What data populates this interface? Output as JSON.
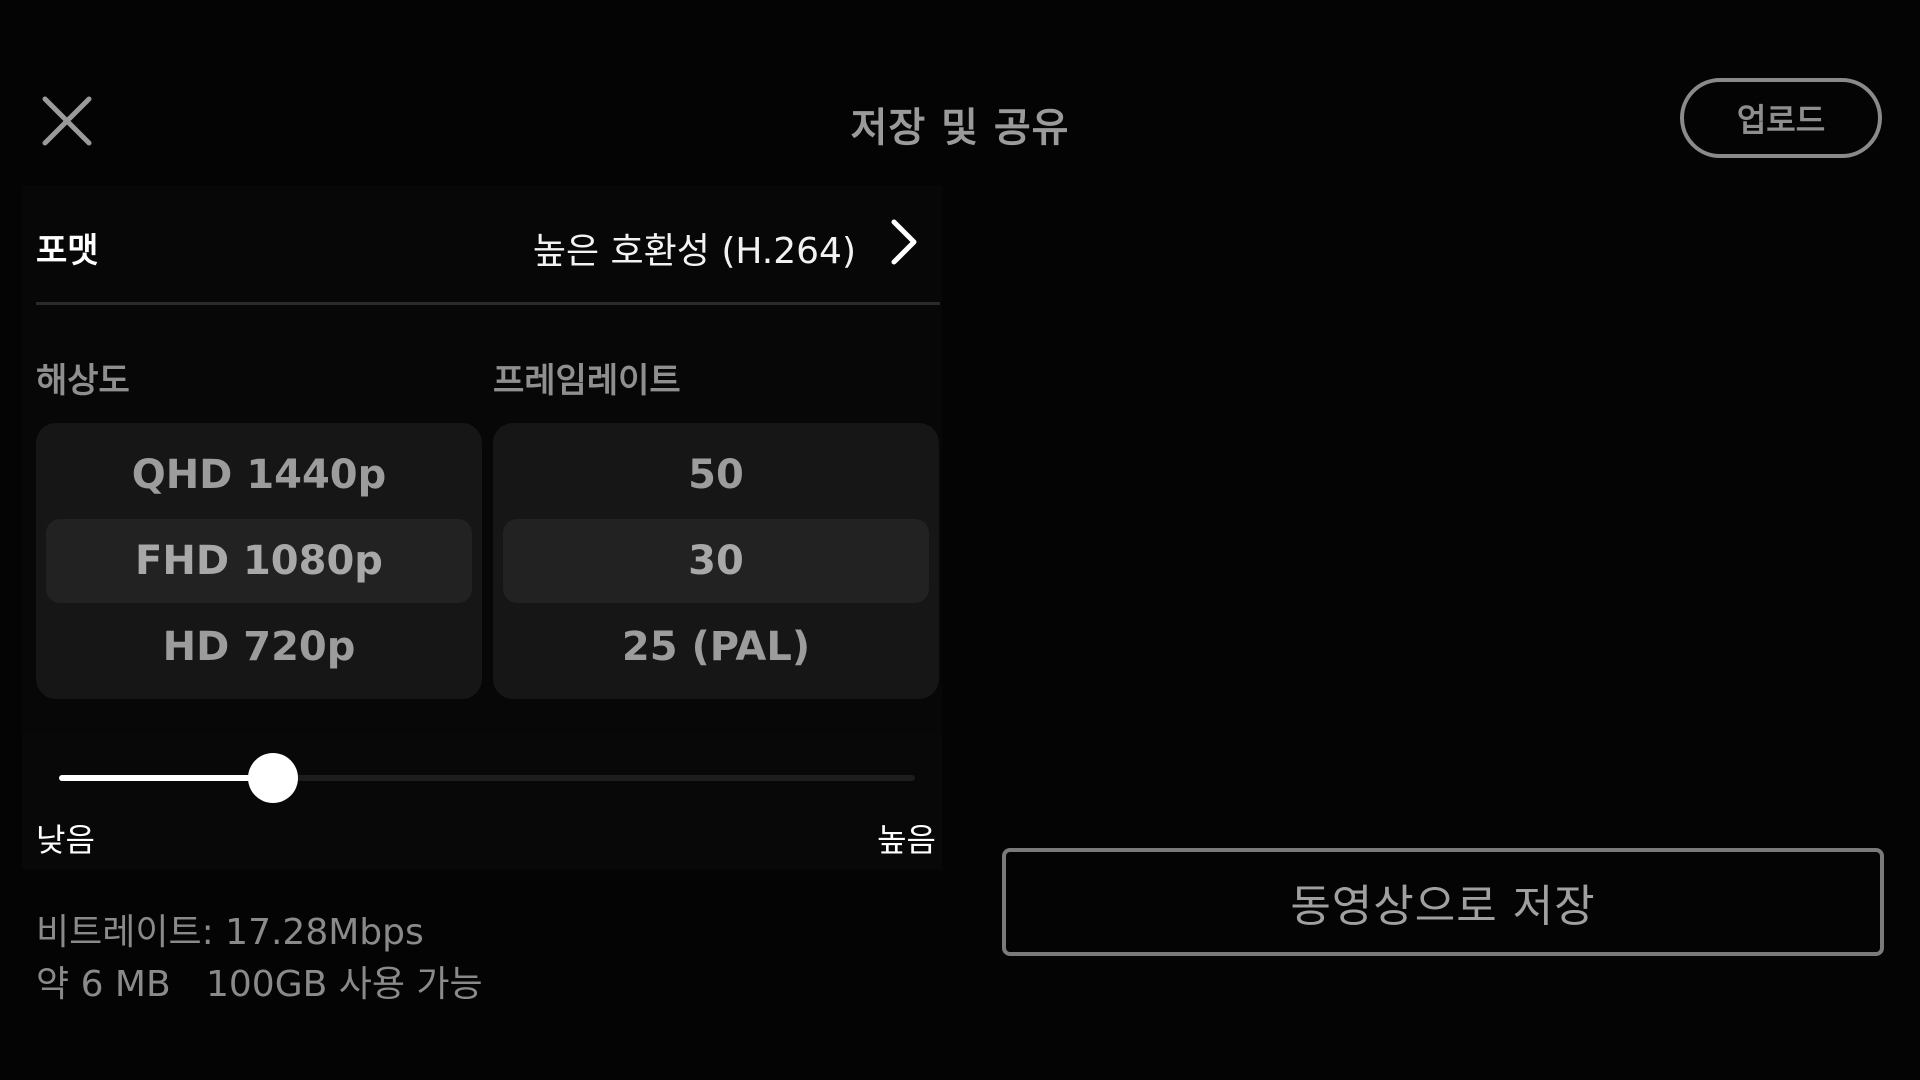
{
  "header": {
    "title": "저장 및 공유",
    "upload_label": "업로드",
    "close_icon": "close-icon"
  },
  "format": {
    "label": "포맷",
    "value": "높은 호환성 (H.264)",
    "icon": "chevron-right-icon"
  },
  "resolution": {
    "label": "해상도",
    "options": [
      "QHD 1440p",
      "FHD 1080p",
      "HD 720p"
    ],
    "selected": "FHD 1080p"
  },
  "framerate": {
    "label": "프레임레이트",
    "options": [
      "50",
      "30",
      "25 (PAL)"
    ],
    "selected": "30"
  },
  "quality": {
    "low_label": "낮음",
    "high_label": "높음",
    "level": 0.25
  },
  "info": {
    "bitrate": "비트레이트: 17.28Mbps",
    "size": "약 6 MB",
    "storage": "100GB 사용 가능"
  },
  "save_label": "동영상으로 저장",
  "colors": {
    "background": "#040404",
    "panel": "#161616",
    "selected": "#222222",
    "accent": "#ffffff"
  }
}
